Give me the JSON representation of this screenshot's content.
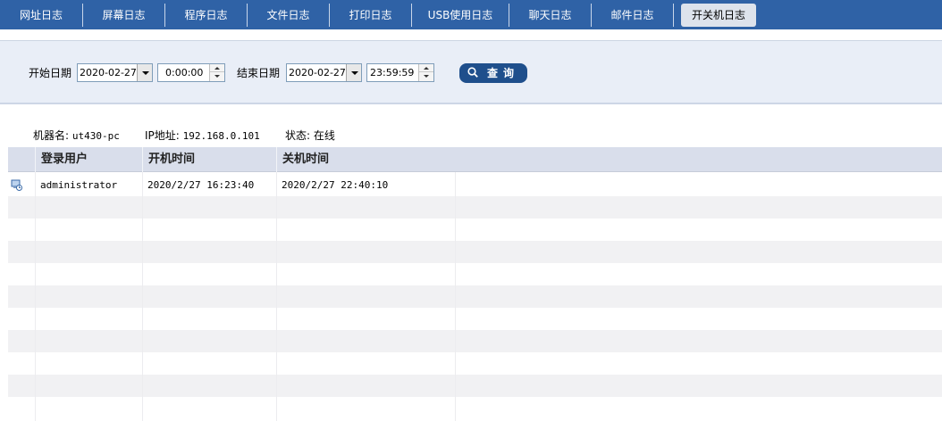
{
  "tabs": [
    {
      "label": "网址日志"
    },
    {
      "label": "屏幕日志"
    },
    {
      "label": "程序日志"
    },
    {
      "label": "文件日志"
    },
    {
      "label": "打印日志"
    },
    {
      "label": "USB使用日志"
    },
    {
      "label": "聊天日志"
    },
    {
      "label": "邮件日志"
    },
    {
      "label": "开关机日志"
    }
  ],
  "active_tab": "开关机日志",
  "query": {
    "start_label": "开始日期",
    "start_date": "2020-02-27",
    "start_time": "0:00:00",
    "end_label": "结束日期",
    "end_date": "2020-02-27",
    "end_time": "23:59:59",
    "button_label": "查询"
  },
  "info": {
    "machine_label": "机器名:",
    "machine_value": "ut430-pc",
    "ip_label": "IP地址:",
    "ip_value": "192.168.0.101",
    "status_label": "状态:",
    "status_value": "在线"
  },
  "table": {
    "columns": [
      "登录用户",
      "开机时间",
      "关机时间"
    ],
    "rows": [
      {
        "user": "administrator",
        "boot_time": "2020/2/27 16:23:40",
        "shutdown_time": "2020/2/27 22:40:10"
      }
    ]
  },
  "colors": {
    "tabbar_bg": "#2f62a6",
    "query_bg": "#e9eef7",
    "button_bg": "#1f4f8c",
    "header_bg": "#d9deeb"
  }
}
